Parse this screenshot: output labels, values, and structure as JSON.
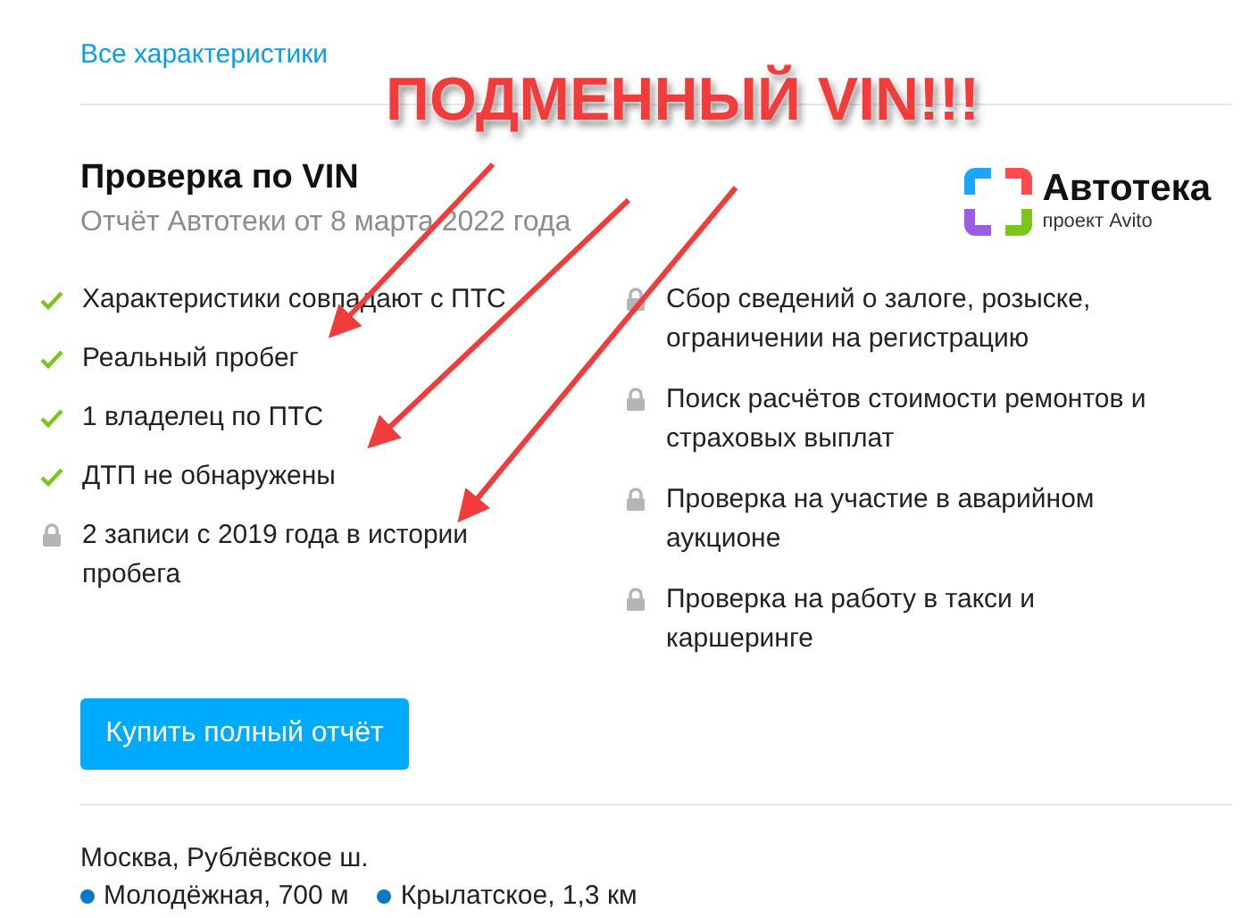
{
  "all_specs_link": "Все характеристики",
  "vin_check": {
    "title": "Проверка по VIN",
    "subtitle": "Отчёт Автотеки от 8 марта 2022 года",
    "logo": {
      "name": "Автотека",
      "tagline": "проект Avito"
    },
    "left_items": [
      {
        "text": "Характеристики совпадают с ПТС",
        "locked": false
      },
      {
        "text": "Реальный пробег",
        "locked": false
      },
      {
        "text": "1 владелец по ПТС",
        "locked": false
      },
      {
        "text": "ДТП не обнаружены",
        "locked": false
      },
      {
        "text": "2 записи с 2019 года в истории пробега",
        "locked": true
      }
    ],
    "right_items": [
      {
        "text": "Сбор сведений о залоге, розыске, ограничении на регистрацию",
        "locked": true
      },
      {
        "text": "Поиск расчётов стоимости ремонтов и страховых выплат",
        "locked": true
      },
      {
        "text": "Проверка на участие в аварийном аукционе",
        "locked": true
      },
      {
        "text": "Проверка на работу в такси и каршеринге",
        "locked": true
      }
    ],
    "buy_button": "Купить полный отчёт"
  },
  "location": {
    "address": "Москва, Рублёвское ш.",
    "metro": [
      "Молодёжная, 700 м",
      "Крылатское, 1,3 км"
    ]
  },
  "annotation": {
    "text": "ПОДМЕННЫЙ VIN!!!"
  }
}
